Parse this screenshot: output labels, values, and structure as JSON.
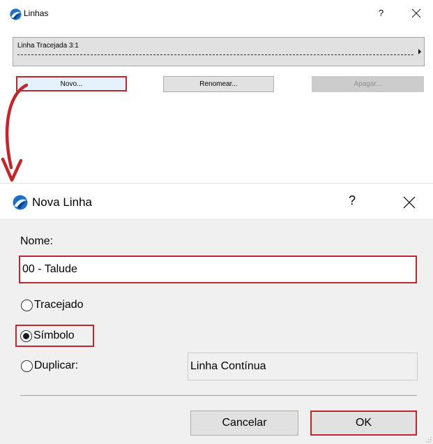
{
  "top_dialog": {
    "title": "Linhas",
    "help_label": "?",
    "close_icon": "close-icon",
    "line_item": {
      "name": "Linha Tracejada 3:1"
    },
    "buttons": {
      "new_label": "Novo...",
      "rename_label": "Renomear...",
      "delete_label": "Apagar..."
    }
  },
  "bottom_dialog": {
    "title": "Nova Linha",
    "help_label": "?",
    "name_label": "Nome:",
    "name_value": "00 - Talude",
    "options": {
      "dashed_label": "Tracejado",
      "symbol_label": "Símbolo",
      "duplicate_label": "Duplicar:"
    },
    "selected_option": "Símbolo",
    "duplicate_source": "Linha Contínua",
    "buttons": {
      "cancel_label": "Cancelar",
      "ok_label": "OK"
    }
  },
  "colors": {
    "highlight": "#c0272d",
    "dialog_background": "#f0f0f0",
    "button_background": "#e1e1e1",
    "selected_button_background": "#e5f1fb"
  },
  "icons": [
    "archicad-app-icon",
    "close-icon",
    "arrow-right-icon",
    "red-curved-arrow-icon",
    "resize-grip-icon"
  ]
}
